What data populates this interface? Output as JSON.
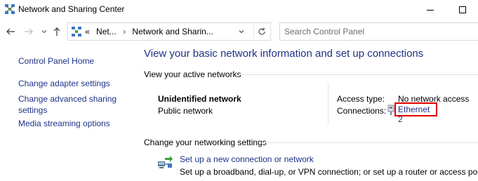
{
  "window": {
    "title": "Network and Sharing Center",
    "icon": "network-sharing-icon"
  },
  "address": {
    "crumbs": [
      "Net...",
      "Network and Sharin..."
    ],
    "overflow": "«"
  },
  "search": {
    "placeholder": "Search Control Panel"
  },
  "sidebar": {
    "items": [
      {
        "label": "Control Panel Home"
      },
      {
        "label": "Change adapter settings"
      },
      {
        "label": "Change advanced sharing settings"
      },
      {
        "label": "Media streaming options"
      }
    ]
  },
  "main": {
    "title": "View your basic network information and set up connections",
    "active_networks_header": "View your active networks",
    "network": {
      "name": "Unidentified network",
      "category": "Public network",
      "access_type_label": "Access type:",
      "access_type_value": "No network access",
      "connections_label": "Connections:",
      "connection_link": "Ethernet 2"
    },
    "change_settings_header": "Change your networking settings",
    "setup": {
      "link": "Set up a new connection or network",
      "description": "Set up a broadband, dial-up, or VPN connection; or set up a router or access point."
    }
  },
  "colors": {
    "link": "#1e3287",
    "highlight_border": "#e00000"
  }
}
